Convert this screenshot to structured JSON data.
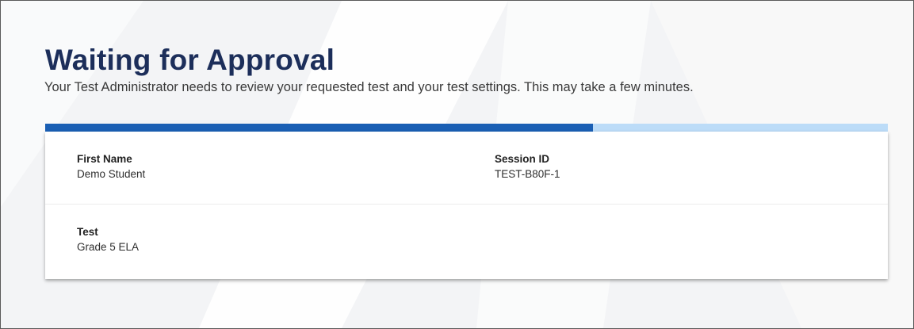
{
  "page": {
    "title": "Waiting for Approval",
    "subtitle": "Your Test Administrator needs to review your requested test and your test settings. This may take a few minutes.",
    "progress_percent": 65
  },
  "student_info": {
    "first_name": {
      "label": "First Name",
      "value": "Demo Student"
    },
    "session_id": {
      "label": "Session ID",
      "value": "TEST-B80F-1"
    },
    "test": {
      "label": "Test",
      "value": "Grade 5 ELA"
    }
  },
  "colors": {
    "title": "#1c2e5a",
    "progress_fill": "#1a5fb4",
    "progress_track": "#bcdcf8"
  }
}
